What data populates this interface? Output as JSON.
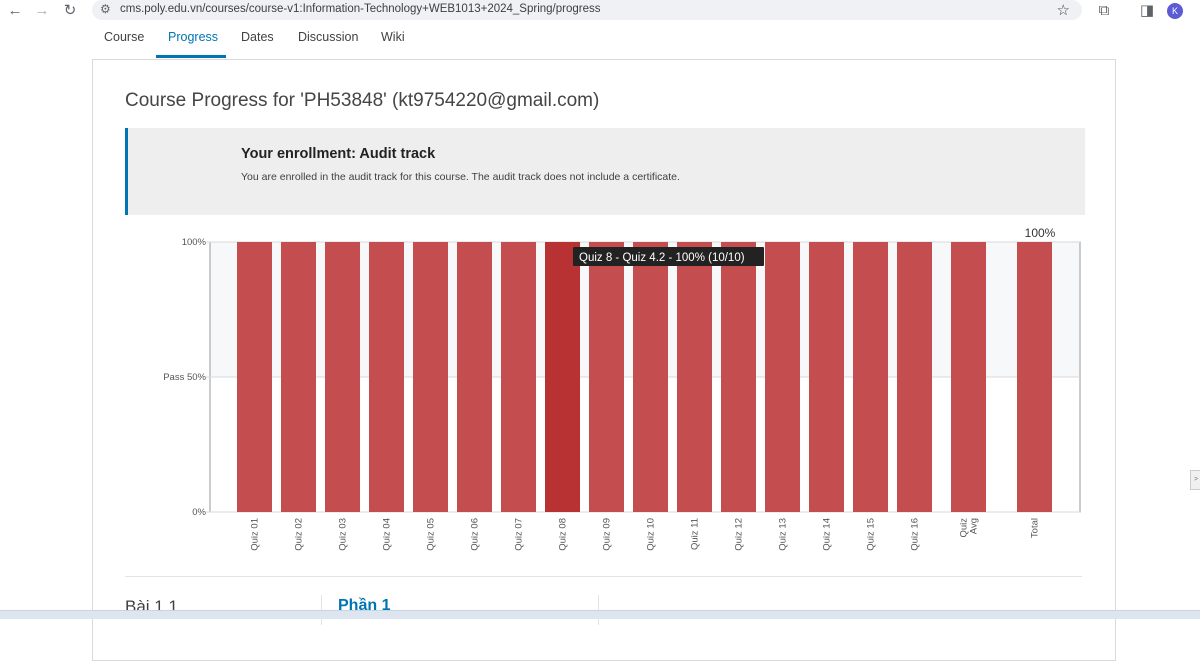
{
  "browser": {
    "url": "cms.poly.edu.vn/courses/course-v1:Information-Technology+WEB1013+2024_Spring/progress",
    "profile_initial": "K"
  },
  "nav": {
    "tabs": [
      {
        "label": "Course"
      },
      {
        "label": "Progress"
      },
      {
        "label": "Dates"
      },
      {
        "label": "Discussion"
      },
      {
        "label": "Wiki"
      }
    ]
  },
  "page": {
    "title": "Course Progress for 'PH53848' (kt9754220@gmail.com)"
  },
  "enrollment": {
    "heading": "Your enrollment: Audit track",
    "message": "You are enrolled in the audit track for this course. The audit track does not include a certificate."
  },
  "sections": {
    "first_label": "Bài 1.1",
    "second_label": "Phần 1"
  },
  "colors": {
    "bar": "#c34d4f",
    "bar_highlight": "#b83133",
    "accent": "#0075b4"
  },
  "chart_data": {
    "type": "bar",
    "categories": [
      "Quiz 01",
      "Quiz 02",
      "Quiz 03",
      "Quiz 04",
      "Quiz 05",
      "Quiz 06",
      "Quiz 07",
      "Quiz 08",
      "Quiz 09",
      "Quiz 10",
      "Quiz 11",
      "Quiz 12",
      "Quiz 13",
      "Quiz 14",
      "Quiz 15",
      "Quiz 16",
      "Quiz Avg",
      "Total"
    ],
    "values": [
      100,
      100,
      100,
      100,
      100,
      100,
      100,
      100,
      100,
      100,
      100,
      100,
      100,
      100,
      100,
      100,
      100,
      100
    ],
    "y_ticks": [
      {
        "value": 100,
        "label": "100%"
      },
      {
        "value": 50,
        "label": "Pass 50%"
      },
      {
        "value": 0,
        "label": "0%"
      }
    ],
    "ylim": [
      0,
      100
    ],
    "total_label": "100%",
    "tooltip": {
      "category": "Quiz 08",
      "text": "Quiz 8 - Quiz 4.2 - 100% (10/10)"
    }
  }
}
